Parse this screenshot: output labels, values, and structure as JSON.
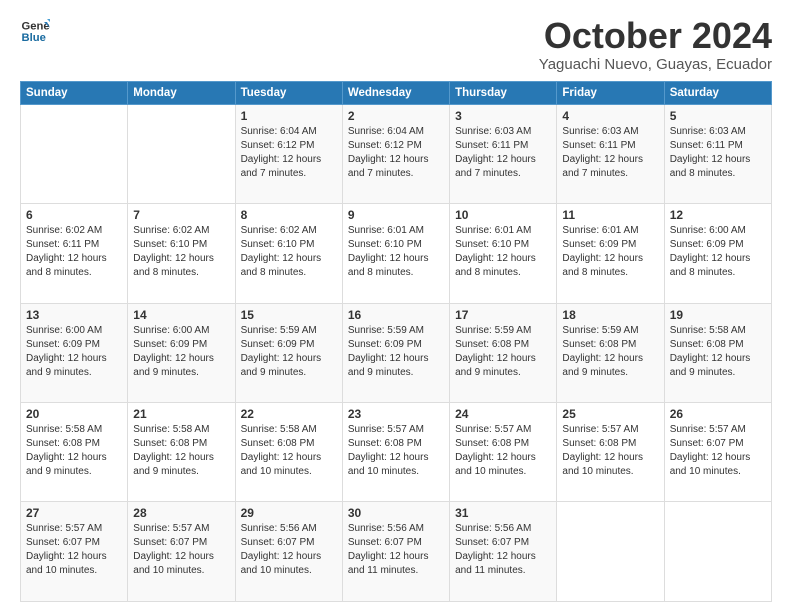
{
  "logo": {
    "line1": "General",
    "line2": "Blue"
  },
  "title": "October 2024",
  "location": "Yaguachi Nuevo, Guayas, Ecuador",
  "days_header": [
    "Sunday",
    "Monday",
    "Tuesday",
    "Wednesday",
    "Thursday",
    "Friday",
    "Saturday"
  ],
  "weeks": [
    [
      {
        "day": "",
        "detail": ""
      },
      {
        "day": "",
        "detail": ""
      },
      {
        "day": "1",
        "detail": "Sunrise: 6:04 AM\nSunset: 6:12 PM\nDaylight: 12 hours\nand 7 minutes."
      },
      {
        "day": "2",
        "detail": "Sunrise: 6:04 AM\nSunset: 6:12 PM\nDaylight: 12 hours\nand 7 minutes."
      },
      {
        "day": "3",
        "detail": "Sunrise: 6:03 AM\nSunset: 6:11 PM\nDaylight: 12 hours\nand 7 minutes."
      },
      {
        "day": "4",
        "detail": "Sunrise: 6:03 AM\nSunset: 6:11 PM\nDaylight: 12 hours\nand 7 minutes."
      },
      {
        "day": "5",
        "detail": "Sunrise: 6:03 AM\nSunset: 6:11 PM\nDaylight: 12 hours\nand 8 minutes."
      }
    ],
    [
      {
        "day": "6",
        "detail": "Sunrise: 6:02 AM\nSunset: 6:11 PM\nDaylight: 12 hours\nand 8 minutes."
      },
      {
        "day": "7",
        "detail": "Sunrise: 6:02 AM\nSunset: 6:10 PM\nDaylight: 12 hours\nand 8 minutes."
      },
      {
        "day": "8",
        "detail": "Sunrise: 6:02 AM\nSunset: 6:10 PM\nDaylight: 12 hours\nand 8 minutes."
      },
      {
        "day": "9",
        "detail": "Sunrise: 6:01 AM\nSunset: 6:10 PM\nDaylight: 12 hours\nand 8 minutes."
      },
      {
        "day": "10",
        "detail": "Sunrise: 6:01 AM\nSunset: 6:10 PM\nDaylight: 12 hours\nand 8 minutes."
      },
      {
        "day": "11",
        "detail": "Sunrise: 6:01 AM\nSunset: 6:09 PM\nDaylight: 12 hours\nand 8 minutes."
      },
      {
        "day": "12",
        "detail": "Sunrise: 6:00 AM\nSunset: 6:09 PM\nDaylight: 12 hours\nand 8 minutes."
      }
    ],
    [
      {
        "day": "13",
        "detail": "Sunrise: 6:00 AM\nSunset: 6:09 PM\nDaylight: 12 hours\nand 9 minutes."
      },
      {
        "day": "14",
        "detail": "Sunrise: 6:00 AM\nSunset: 6:09 PM\nDaylight: 12 hours\nand 9 minutes."
      },
      {
        "day": "15",
        "detail": "Sunrise: 5:59 AM\nSunset: 6:09 PM\nDaylight: 12 hours\nand 9 minutes."
      },
      {
        "day": "16",
        "detail": "Sunrise: 5:59 AM\nSunset: 6:09 PM\nDaylight: 12 hours\nand 9 minutes."
      },
      {
        "day": "17",
        "detail": "Sunrise: 5:59 AM\nSunset: 6:08 PM\nDaylight: 12 hours\nand 9 minutes."
      },
      {
        "day": "18",
        "detail": "Sunrise: 5:59 AM\nSunset: 6:08 PM\nDaylight: 12 hours\nand 9 minutes."
      },
      {
        "day": "19",
        "detail": "Sunrise: 5:58 AM\nSunset: 6:08 PM\nDaylight: 12 hours\nand 9 minutes."
      }
    ],
    [
      {
        "day": "20",
        "detail": "Sunrise: 5:58 AM\nSunset: 6:08 PM\nDaylight: 12 hours\nand 9 minutes."
      },
      {
        "day": "21",
        "detail": "Sunrise: 5:58 AM\nSunset: 6:08 PM\nDaylight: 12 hours\nand 9 minutes."
      },
      {
        "day": "22",
        "detail": "Sunrise: 5:58 AM\nSunset: 6:08 PM\nDaylight: 12 hours\nand 10 minutes."
      },
      {
        "day": "23",
        "detail": "Sunrise: 5:57 AM\nSunset: 6:08 PM\nDaylight: 12 hours\nand 10 minutes."
      },
      {
        "day": "24",
        "detail": "Sunrise: 5:57 AM\nSunset: 6:08 PM\nDaylight: 12 hours\nand 10 minutes."
      },
      {
        "day": "25",
        "detail": "Sunrise: 5:57 AM\nSunset: 6:08 PM\nDaylight: 12 hours\nand 10 minutes."
      },
      {
        "day": "26",
        "detail": "Sunrise: 5:57 AM\nSunset: 6:07 PM\nDaylight: 12 hours\nand 10 minutes."
      }
    ],
    [
      {
        "day": "27",
        "detail": "Sunrise: 5:57 AM\nSunset: 6:07 PM\nDaylight: 12 hours\nand 10 minutes."
      },
      {
        "day": "28",
        "detail": "Sunrise: 5:57 AM\nSunset: 6:07 PM\nDaylight: 12 hours\nand 10 minutes."
      },
      {
        "day": "29",
        "detail": "Sunrise: 5:56 AM\nSunset: 6:07 PM\nDaylight: 12 hours\nand 10 minutes."
      },
      {
        "day": "30",
        "detail": "Sunrise: 5:56 AM\nSunset: 6:07 PM\nDaylight: 12 hours\nand 11 minutes."
      },
      {
        "day": "31",
        "detail": "Sunrise: 5:56 AM\nSunset: 6:07 PM\nDaylight: 12 hours\nand 11 minutes."
      },
      {
        "day": "",
        "detail": ""
      },
      {
        "day": "",
        "detail": ""
      }
    ]
  ]
}
